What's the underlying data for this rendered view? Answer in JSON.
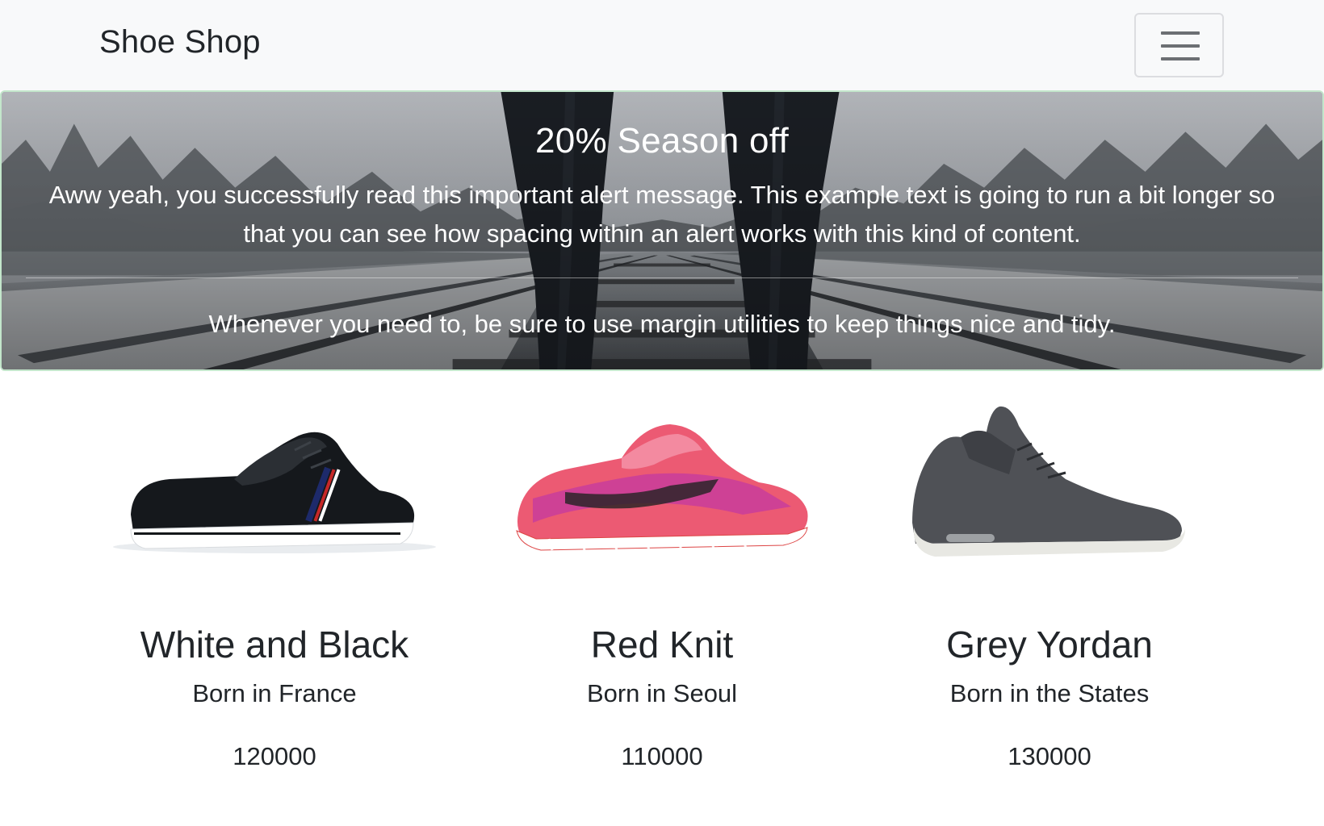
{
  "navbar": {
    "brand": "Shoe Shop",
    "toggler_icon": "hamburger-menu-icon"
  },
  "alert": {
    "title": "20% Season off",
    "text": "Aww yeah, you successfully read this important alert message. This example text is going to run a bit longer so that you can see how spacing within an alert works with this kind of content.",
    "footer": "Whenever you need to, be sure to use margin utilities to keep things nice and tidy.",
    "border_color": "#c3e6cb"
  },
  "products": [
    {
      "name": "White and Black",
      "origin": "Born in France",
      "price": "120000"
    },
    {
      "name": "Red Knit",
      "origin": "Born in Seoul",
      "price": "110000"
    },
    {
      "name": "Grey Yordan",
      "origin": "Born in the States",
      "price": "130000"
    }
  ]
}
